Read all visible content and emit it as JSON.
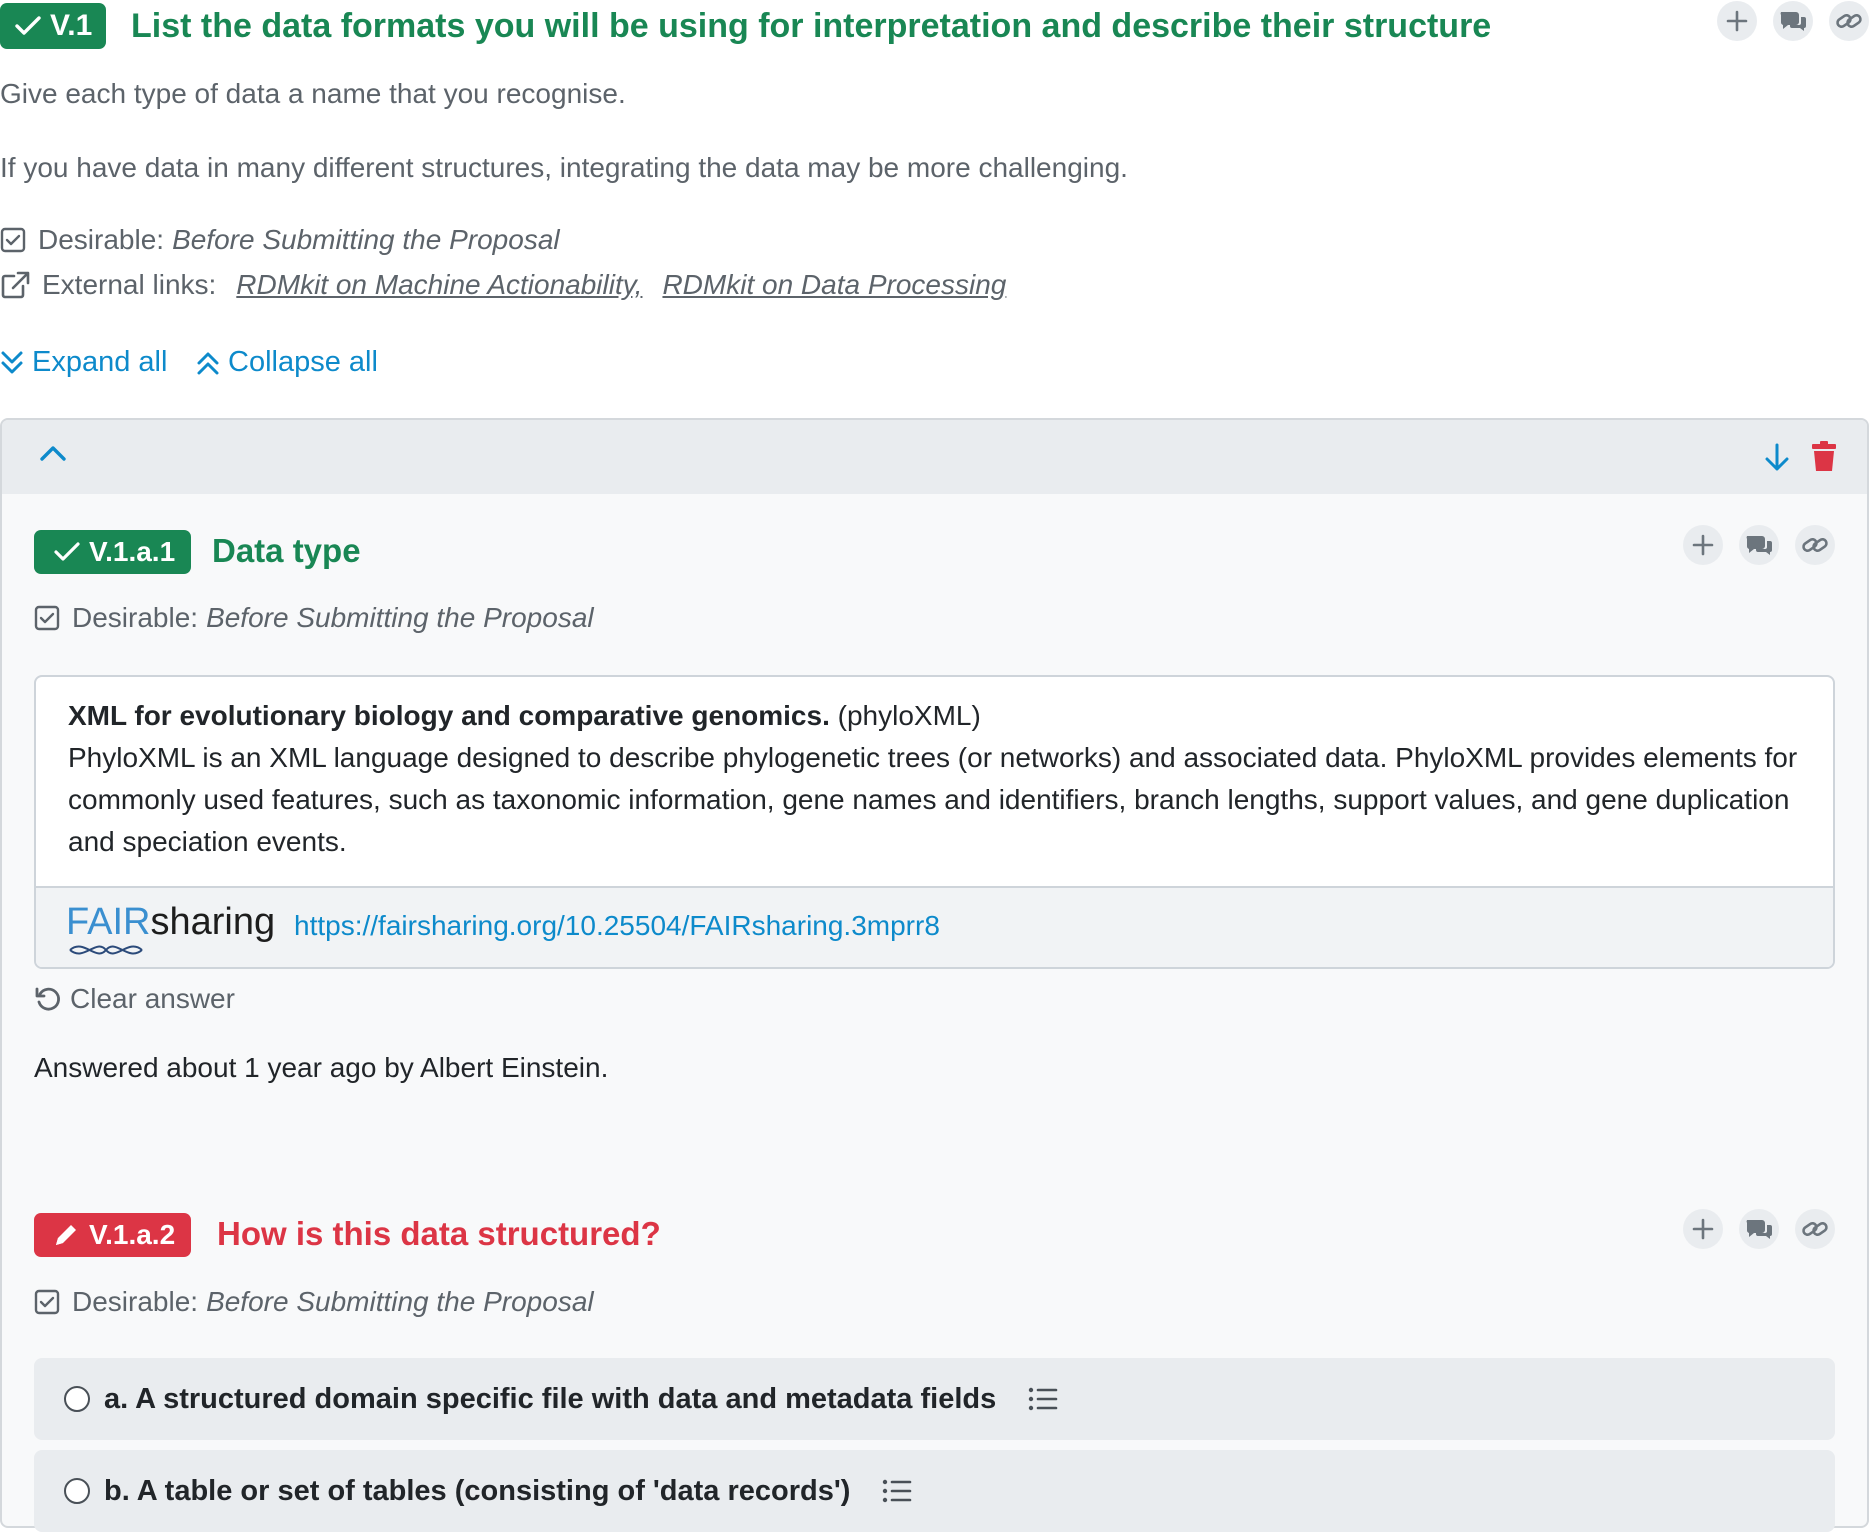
{
  "question": {
    "badge": "V.1",
    "title": "List the data formats you will be using for interpretation and describe their structure",
    "description": [
      "Give each type of data a name that you recognise.",
      "If you have data in many different structures, integrating the data may be more challenging."
    ],
    "desirable_label": "Desirable:",
    "desirable_value": "Before Submitting the Proposal",
    "external_links_label": "External links:",
    "external_links": [
      "RDMkit on Machine Actionability,",
      "RDMkit on Data Processing"
    ],
    "expand_all": "Expand all",
    "collapse_all": "Collapse all"
  },
  "item": {
    "subquestion1": {
      "badge": "V.1.a.1",
      "title": "Data type",
      "desirable_label": "Desirable:",
      "desirable_value": "Before Submitting the Proposal",
      "answer": {
        "name": "XML for evolutionary biology and comparative genomics.",
        "abbr": "(phyloXML)",
        "description": "PhyloXML is an XML language designed to describe phylogenetic trees (or networks) and associated data. PhyloXML provides elements for commonly used features, such as taxonomic information, gene names and identifiers, branch lengths, support values, and gene duplication and speciation events.",
        "logo_fair": "FAIR",
        "logo_sharing": "sharing",
        "url": "https://fairsharing.org/10.25504/FAIRsharing.3mprr8"
      },
      "clear_answer": "Clear answer",
      "answered_by": "Answered about 1 year ago by Albert Einstein."
    },
    "subquestion2": {
      "badge": "V.1.a.2",
      "title": "How is this data structured?",
      "desirable_label": "Desirable:",
      "desirable_value": "Before Submitting the Proposal",
      "options": [
        "a. A structured domain specific file with data and metadata fields",
        "b. A table or set of tables (consisting of 'data records')"
      ]
    }
  },
  "colors": {
    "success": "#198754",
    "danger": "#dc3545",
    "link": "#0d8acb",
    "muted": "#5c636a"
  }
}
